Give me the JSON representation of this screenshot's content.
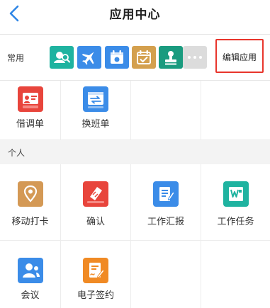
{
  "header": {
    "title": "应用中心",
    "back_icon": "chevron-left-icon"
  },
  "common": {
    "label": "常用",
    "apps": [
      {
        "icon": "contacts-icon",
        "color": "#1fb3a0"
      },
      {
        "icon": "airplane-icon",
        "color": "#3b8ce8"
      },
      {
        "icon": "calendar-icon",
        "color": "#3b8ce8"
      },
      {
        "icon": "check-calendar-icon",
        "color": "#d4a04e"
      },
      {
        "icon": "stamp-icon",
        "color": "#1a9b7f"
      }
    ],
    "more_icon": "more-icon",
    "edit_label": "编辑应用"
  },
  "apps_top": [
    {
      "label": "借调单",
      "icon": "transfer-form-icon",
      "color": "#e8453c"
    },
    {
      "label": "换班单",
      "icon": "shift-swap-icon",
      "color": "#3b8ce8"
    }
  ],
  "personal": {
    "label": "个人",
    "apps": [
      {
        "label": "移动打卡",
        "icon": "location-icon",
        "color": "#d49955"
      },
      {
        "label": "确认",
        "icon": "confirm-icon",
        "color": "#e8453c"
      },
      {
        "label": "工作汇报",
        "icon": "report-icon",
        "color": "#3b8ce8"
      },
      {
        "label": "工作任务",
        "icon": "task-icon",
        "color": "#1fb3a0"
      },
      {
        "label": "会议",
        "icon": "meeting-icon",
        "color": "#3b8ce8"
      },
      {
        "label": "电子签约",
        "icon": "e-sign-icon",
        "color": "#f08a24"
      }
    ]
  },
  "colors": {
    "accent": "#3b8ce8",
    "highlight": "#e8352c",
    "separator": "#f3f3f3"
  }
}
